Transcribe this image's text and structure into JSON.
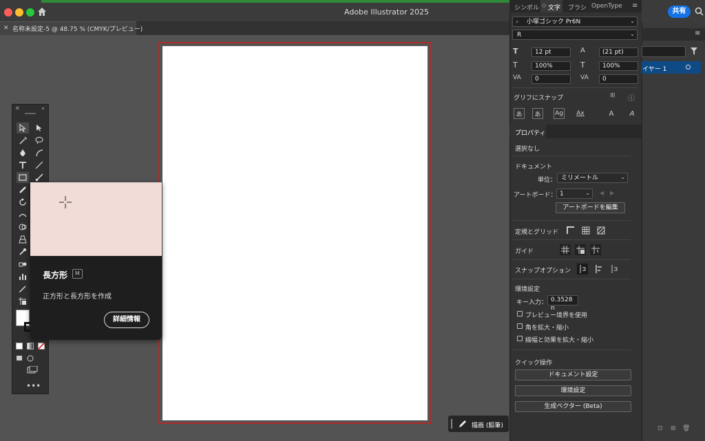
{
  "app": {
    "title": "Adobe Illustrator 2025",
    "share_label": "共有"
  },
  "document_tab": {
    "title": "名称未設定-5 @ 48.75 % (CMYK/プレビュー)"
  },
  "tooltip": {
    "title": "長方形",
    "shortcut": "M",
    "description": "正方形と長方形を作成",
    "learn_more": "詳細情報"
  },
  "panel_tabs": [
    "シンボル",
    "文字",
    "ブラシ",
    "OpenType"
  ],
  "character": {
    "font_family": "小塚ゴシック Pr6N",
    "font_style": "R",
    "font_size": "12 pt",
    "leading": "(21 pt)",
    "vertical_scale": "100%",
    "horizontal_scale": "100%",
    "kerning": "0",
    "tracking": "0",
    "snap_to_glyph": "グリフにスナップ"
  },
  "properties": {
    "tab": "プロパティ",
    "selection": "選択なし",
    "document_heading": "ドキュメント",
    "units_label": "単位：",
    "units_value": "ミリメートル",
    "artboard_label": "アートボード：",
    "artboard_value": "1",
    "edit_artboards": "アートボードを編集",
    "rulers_grids": "定規とグリッド",
    "guides": "ガイド",
    "snap_options": "スナップオプション",
    "preferences_heading": "環境設定",
    "key_input_label": "キー入力：",
    "key_input_value": "0.3528 n",
    "use_preview_bounds": "プレビュー境界を使用",
    "scale_corners": "角を拡大・縮小",
    "scale_strokes": "線幅と効果を拡大・縮小",
    "quick_actions": "クイック操作",
    "document_setup": "ドキュメント設定",
    "preferences_button": "環境設定",
    "generative_vector": "生成ベクター (Beta)"
  },
  "layers": {
    "layer_name": "イヤー 1"
  },
  "draw_widget": {
    "label": "描画 (鉛筆)"
  },
  "colors": {
    "accent": "#1473e6",
    "artboard_border": "#b22a2a",
    "tooltip_preview": "#f1dcd8"
  }
}
